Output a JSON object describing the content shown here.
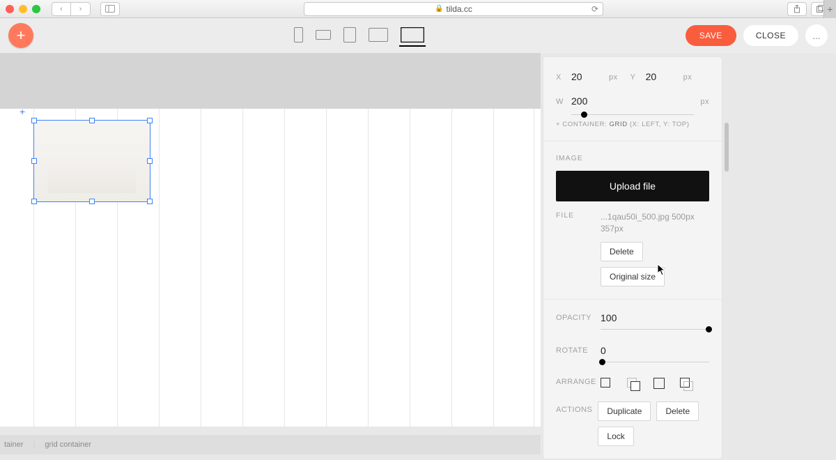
{
  "browser": {
    "url": "tilda.cc",
    "lock_icon": "lock-icon"
  },
  "toolbar": {
    "save_label": "SAVE",
    "close_label": "CLOSE",
    "more_label": "..."
  },
  "footer": {
    "item1": "tainer",
    "item2": "grid container"
  },
  "inspector": {
    "x_label": "X",
    "x_value": "20",
    "x_unit": "px",
    "y_label": "Y",
    "y_value": "20",
    "y_unit": "px",
    "w_label": "W",
    "w_value": "200",
    "w_unit": "px",
    "container_prefix": "+ CONTAINER: ",
    "container_grid": "GRID",
    "container_xy": " (X: LEFT, Y: TOP)",
    "image_section": "IMAGE",
    "upload_label": "Upload file",
    "file_label": "FILE",
    "file_name": "...1qau50i_500.jpg 500px 357px",
    "delete_label": "Delete",
    "original_size_label": "Original size",
    "opacity_label": "OPACITY",
    "opacity_value": "100",
    "rotate_label": "ROTATE",
    "rotate_value": "0",
    "arrange_label": "ARRANGE",
    "actions_label": "ACTIONS",
    "duplicate_label": "Duplicate",
    "delete2_label": "Delete",
    "lock_label": "Lock"
  }
}
